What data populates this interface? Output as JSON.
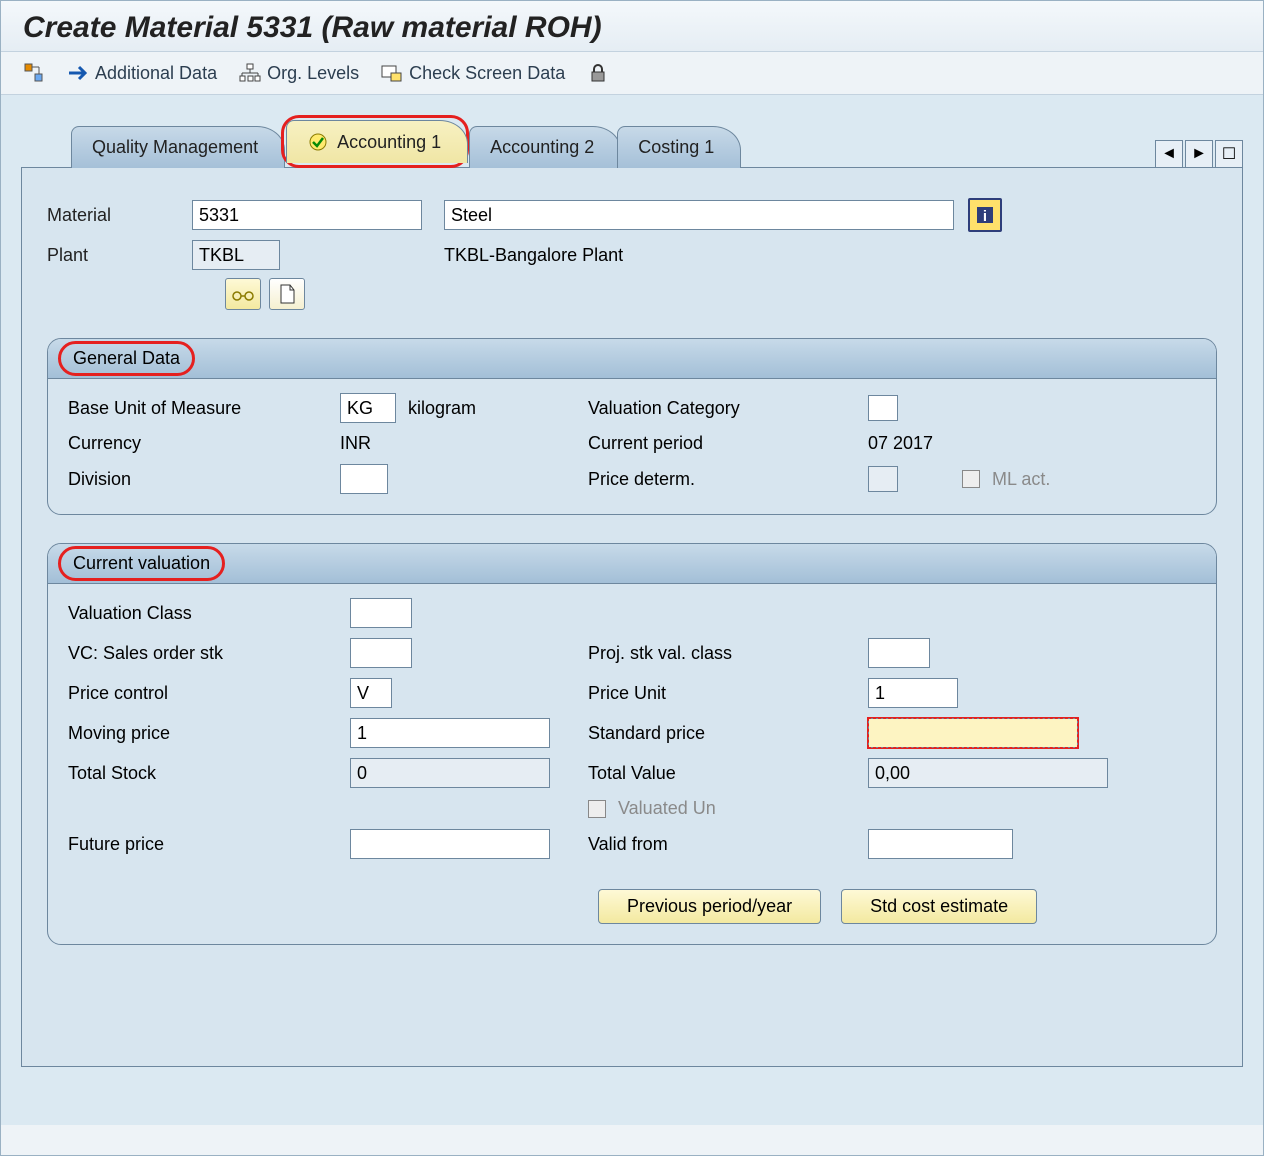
{
  "title": "Create Material 5331 (Raw material ROH)",
  "toolbar": {
    "additional_data": "Additional Data",
    "org_levels": "Org. Levels",
    "check_screen": "Check Screen Data"
  },
  "tabs": {
    "t1": "Quality Management",
    "t2": "Accounting 1",
    "t3": "Accounting 2",
    "t4": "Costing 1"
  },
  "header": {
    "material_label": "Material",
    "material_value": "5331",
    "material_desc": "Steel",
    "plant_label": "Plant",
    "plant_value": "TKBL",
    "plant_desc": "TKBL-Bangalore Plant"
  },
  "general": {
    "title": "General Data",
    "buom_label": "Base Unit of Measure",
    "buom_value": "KG",
    "buom_text": "kilogram",
    "valcat_label": "Valuation Category",
    "currency_label": "Currency",
    "currency_value": "INR",
    "curperiod_label": "Current period",
    "curperiod_value": "07 2017",
    "division_label": "Division",
    "pricedet_label": "Price determ.",
    "mlact_label": "ML act."
  },
  "valuation": {
    "title": "Current valuation",
    "valclass_label": "Valuation Class",
    "vcsos_label": "VC: Sales order stk",
    "projstk_label": "Proj. stk val. class",
    "pricectrl_label": "Price control",
    "pricectrl_value": "V",
    "priceunit_label": "Price Unit",
    "priceunit_value": "1",
    "movprice_label": "Moving price",
    "movprice_value": "1",
    "stdprice_label": "Standard price",
    "totstock_label": "Total Stock",
    "totstock_value": "0",
    "totvalue_label": "Total Value",
    "totvalue_value": "0,00",
    "valun_label": "Valuated Un",
    "future_label": "Future price",
    "validfrom_label": "Valid from"
  },
  "buttons": {
    "prev": "Previous period/year",
    "std": "Std cost estimate"
  }
}
